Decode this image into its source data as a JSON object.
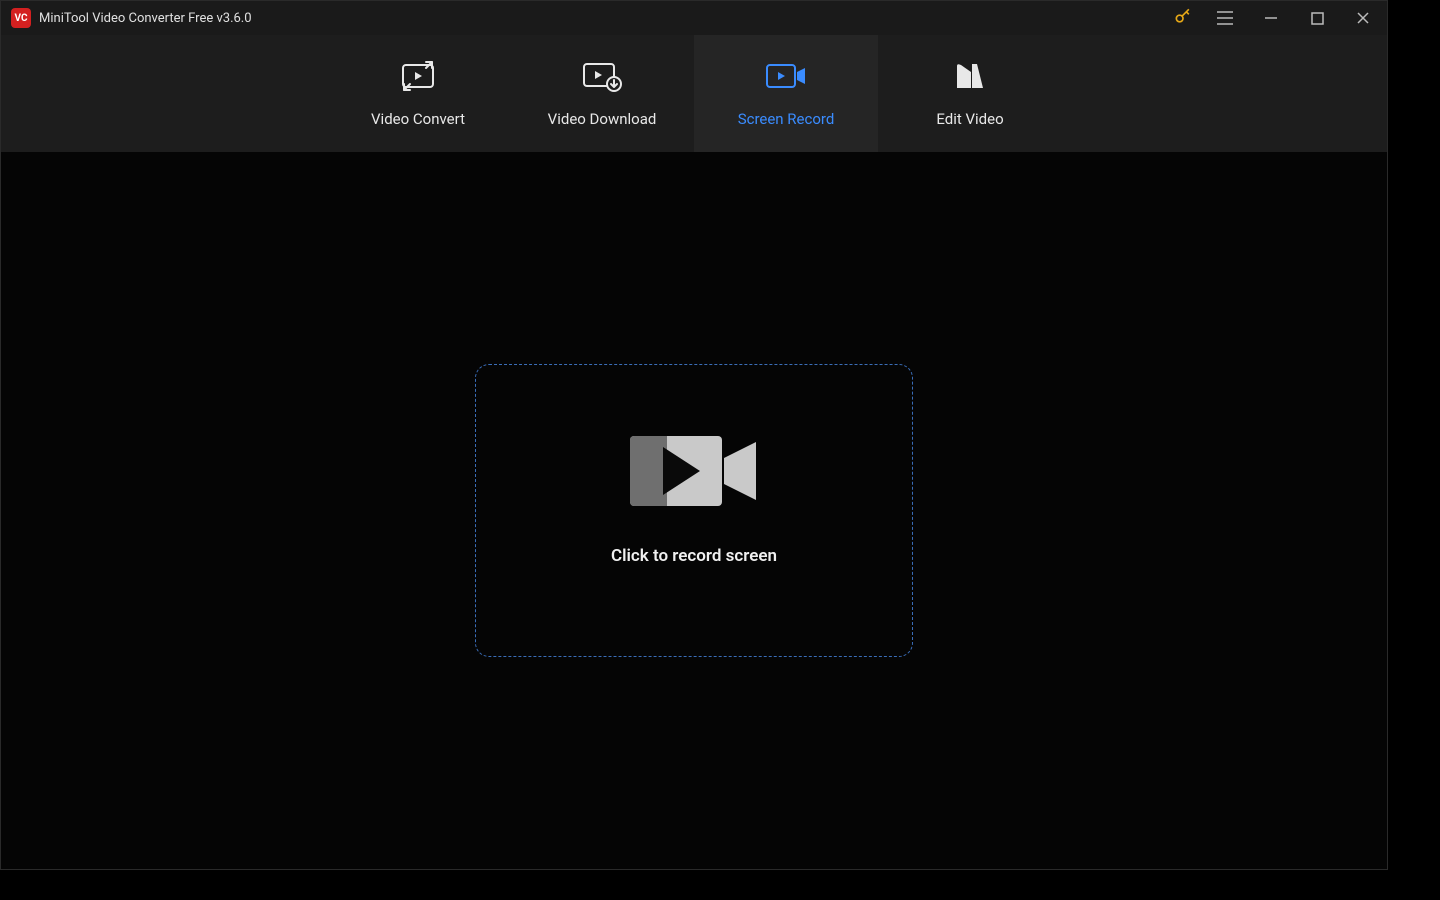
{
  "app": {
    "icon_text": "VC",
    "title": "MiniTool Video Converter Free v3.6.0"
  },
  "tabs": {
    "convert": {
      "label": "Video Convert"
    },
    "download": {
      "label": "Video Download"
    },
    "record": {
      "label": "Screen Record"
    },
    "edit": {
      "label": "Edit Video"
    },
    "active": "record"
  },
  "content": {
    "record_prompt": "Click to record screen"
  },
  "colors": {
    "accent": "#3a8cff",
    "key": "#e6a817",
    "app_icon_bg": "#d32020"
  }
}
